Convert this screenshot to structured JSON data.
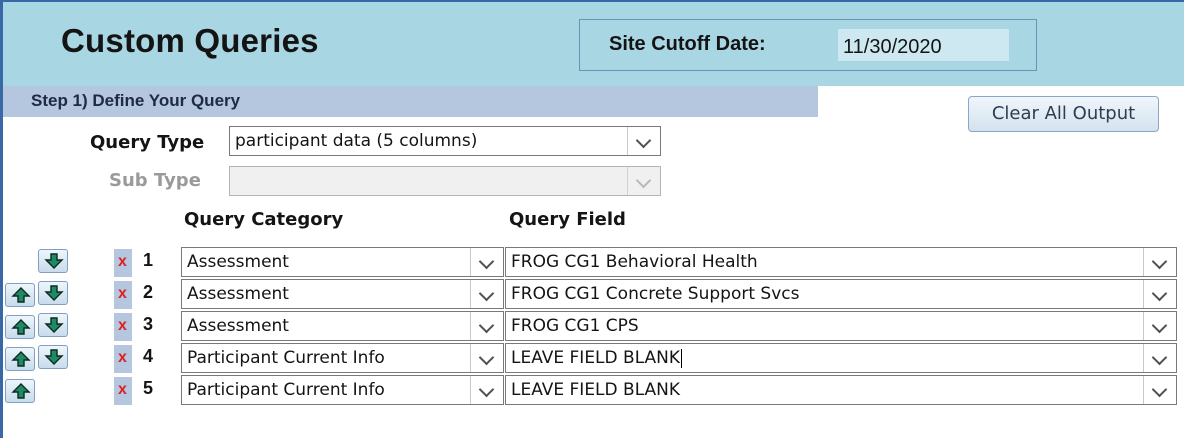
{
  "header": {
    "title": "Custom Queries",
    "cutoff_label": "Site Cutoff Date:",
    "cutoff_value": "11/30/2020"
  },
  "step": {
    "title": "Step 1)  Define Your Query"
  },
  "clear_button": "Clear All Output",
  "query_type": {
    "label": "Query Type",
    "value": "participant data (5 columns)"
  },
  "sub_type": {
    "label": "Sub Type",
    "value": ""
  },
  "columns": {
    "category": "Query Category",
    "field": "Query Field"
  },
  "rows": [
    {
      "num": "1",
      "category": "Assessment",
      "field": "FROG CG1 Behavioral Health",
      "has_up": false,
      "has_down": true
    },
    {
      "num": "2",
      "category": "Assessment",
      "field": "FROG CG1 Concrete Support Svcs",
      "has_up": true,
      "has_down": true
    },
    {
      "num": "3",
      "category": "Assessment",
      "field": "FROG CG1 CPS",
      "has_up": true,
      "has_down": true
    },
    {
      "num": "4",
      "category": "Participant Current Info",
      "field": "LEAVE FIELD BLANK",
      "has_up": true,
      "has_down": true
    },
    {
      "num": "5",
      "category": "Participant Current Info",
      "field": "LEAVE FIELD BLANK",
      "has_up": true,
      "has_down": false
    }
  ],
  "delete_glyph": "x",
  "icons": {
    "up": "arrow-up-icon",
    "down": "arrow-down-icon",
    "dropdown": "chevron-down-icon"
  },
  "colors": {
    "header_band": "#a9d6e3",
    "step_band": "#b4c7de",
    "frame": "#3a67a6",
    "arrow_fill": "#1f8a62",
    "delete": "#e02020"
  }
}
